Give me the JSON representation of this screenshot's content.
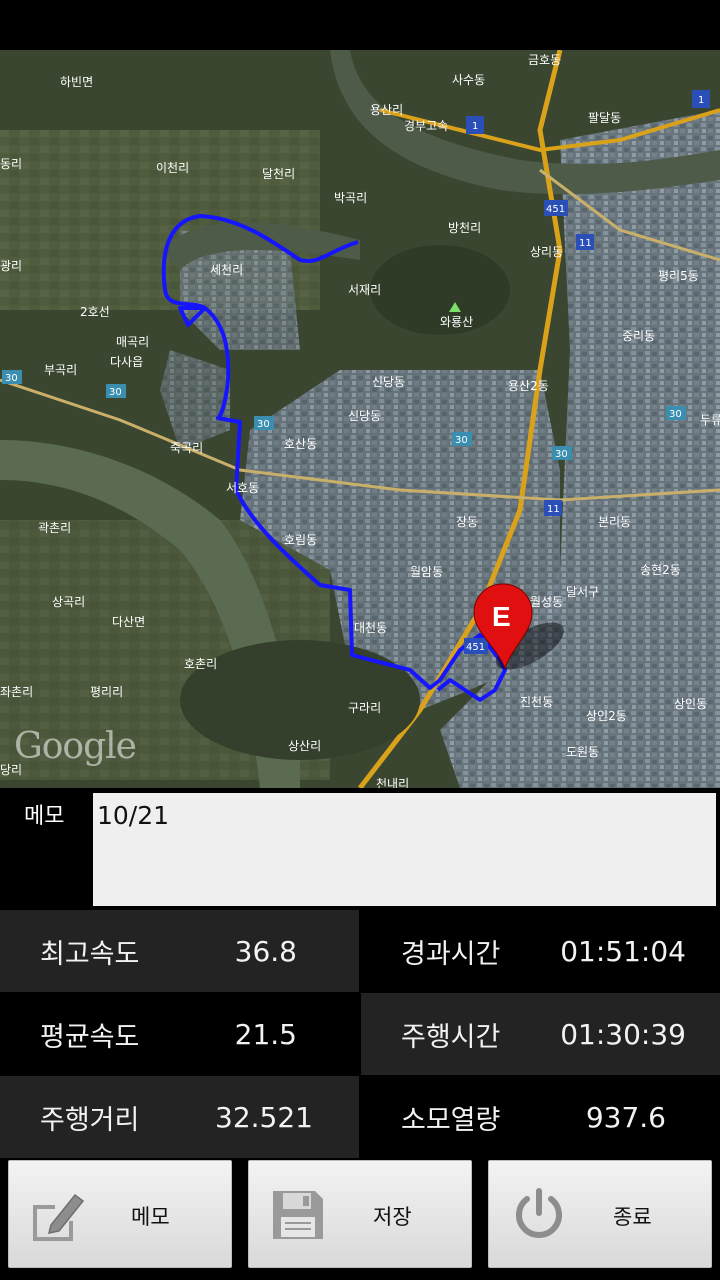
{
  "map": {
    "watermark": "Google",
    "end_marker_letter": "E",
    "labels": [
      {
        "text": "하빈면"
      },
      {
        "text": "금호동"
      },
      {
        "text": "사수동"
      },
      {
        "text": "용산리"
      },
      {
        "text": "경부고속"
      },
      {
        "text": "팔달동"
      },
      {
        "text": "이천리"
      },
      {
        "text": "달천리"
      },
      {
        "text": "박곡리"
      },
      {
        "text": "방천리"
      },
      {
        "text": "상리동"
      },
      {
        "text": "세천리"
      },
      {
        "text": "서재리"
      },
      {
        "text": "와룡산"
      },
      {
        "text": "평리5동"
      },
      {
        "text": "중리동"
      },
      {
        "text": "매곡리"
      },
      {
        "text": "다사읍"
      },
      {
        "text": "부곡리"
      },
      {
        "text": "신당동"
      },
      {
        "text": "용산2동"
      },
      {
        "text": "2호선"
      },
      {
        "text": "호산동"
      },
      {
        "text": "죽곡리"
      },
      {
        "text": "서호동"
      },
      {
        "text": "장동"
      },
      {
        "text": "곽촌리"
      },
      {
        "text": "호림동"
      },
      {
        "text": "본리동"
      },
      {
        "text": "송현2동"
      },
      {
        "text": "월암동"
      },
      {
        "text": "달서구"
      },
      {
        "text": "월성동"
      },
      {
        "text": "상곡리"
      },
      {
        "text": "다산면"
      },
      {
        "text": "대천동"
      },
      {
        "text": "호촌리"
      },
      {
        "text": "평리리"
      },
      {
        "text": "구라리"
      },
      {
        "text": "진천동"
      },
      {
        "text": "상인2동"
      },
      {
        "text": "상인동"
      },
      {
        "text": "상산리"
      },
      {
        "text": "도원동"
      },
      {
        "text": "신당동"
      },
      {
        "text": "두류"
      },
      {
        "text": "광리"
      },
      {
        "text": "동리"
      },
      {
        "text": "좌촌리"
      },
      {
        "text": "당리"
      },
      {
        "text": "천내리"
      }
    ],
    "shields": [
      "1",
      "1",
      "451",
      "11",
      "30",
      "30",
      "30",
      "30",
      "30",
      "11",
      "451",
      "30"
    ]
  },
  "memo": {
    "label": "메모",
    "value": "10/21"
  },
  "stats": {
    "max_speed_label": "최고속도",
    "max_speed_value": "36.8",
    "elapsed_label": "경과시간",
    "elapsed_value": "01:51:04",
    "avg_speed_label": "평균속도",
    "avg_speed_value": "21.5",
    "moving_time_label": "주행시간",
    "moving_time_value": "01:30:39",
    "distance_label": "주행거리",
    "distance_value": "32.521",
    "calories_label": "소모열량",
    "calories_value": "937.6"
  },
  "buttons": {
    "memo_label": "메모",
    "save_label": "저장",
    "quit_label": "종료"
  },
  "colors": {
    "route": "#1515ff",
    "marker": "#e01010"
  }
}
